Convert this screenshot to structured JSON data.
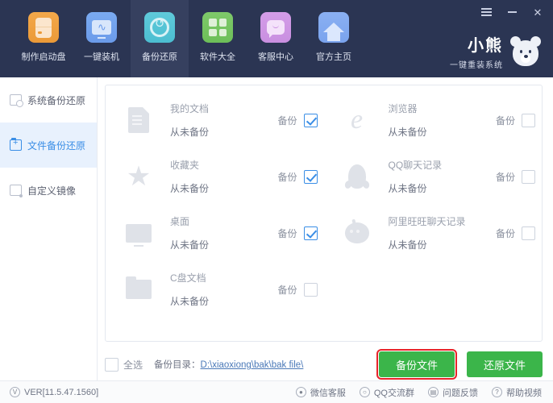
{
  "window": {
    "menu_icon": "hamburger-icon",
    "minimize_icon": "minimize-icon",
    "close_label": "✕"
  },
  "brand": {
    "name": "小熊",
    "slogan": "一键重装系统",
    "logo_icon": "bear-logo-icon"
  },
  "toolbar": {
    "active_index": 2,
    "tabs": [
      {
        "label": "制作启动盘",
        "icon": "usb-disk-icon"
      },
      {
        "label": "一键装机",
        "icon": "monitor-install-icon"
      },
      {
        "label": "备份还原",
        "icon": "backup-restore-icon"
      },
      {
        "label": "软件大全",
        "icon": "software-grid-icon"
      },
      {
        "label": "客服中心",
        "icon": "customer-service-icon"
      },
      {
        "label": "官方主页",
        "icon": "home-icon"
      }
    ]
  },
  "sidebar": {
    "active_index": 1,
    "items": [
      {
        "label": "系统备份还原",
        "icon": "system-backup-icon"
      },
      {
        "label": "文件备份还原",
        "icon": "file-backup-icon"
      },
      {
        "label": "自定义镜像",
        "icon": "custom-image-icon"
      }
    ]
  },
  "main": {
    "backup_label": "备份",
    "items": [
      {
        "title": "我的文档",
        "status": "从未备份",
        "icon": "document-icon",
        "checked": true
      },
      {
        "title": "浏览器",
        "status": "从未备份",
        "icon": "ie-browser-icon",
        "checked": false
      },
      {
        "title": "收藏夹",
        "status": "从未备份",
        "icon": "star-favorites-icon",
        "checked": true
      },
      {
        "title": "QQ聊天记录",
        "status": "从未备份",
        "icon": "qq-penguin-icon",
        "checked": false
      },
      {
        "title": "桌面",
        "status": "从未备份",
        "icon": "desktop-monitor-icon",
        "checked": true
      },
      {
        "title": "阿里旺旺聊天记录",
        "status": "从未备份",
        "icon": "aliwangwang-icon",
        "checked": false
      },
      {
        "title": "C盘文档",
        "status": "从未备份",
        "icon": "folder-icon",
        "checked": false
      }
    ]
  },
  "actionbar": {
    "select_all_label": "全选",
    "select_all_checked": false,
    "backup_dir_label": "备份目录：",
    "backup_dir_path": "D:\\xiaoxiong\\bak\\bak file\\",
    "backup_button": "备份文件",
    "restore_button": "还原文件",
    "highlight_color": "#e8232a",
    "button_color": "#3bb54a"
  },
  "footer": {
    "version": "VER[11.5.47.1560]",
    "version_icon": "circled-v-icon",
    "links": [
      {
        "label": "微信客服",
        "icon": "wechat-icon",
        "glyph": "●"
      },
      {
        "label": "QQ交流群",
        "icon": "qq-group-icon",
        "glyph": "○"
      },
      {
        "label": "问题反馈",
        "icon": "feedback-icon",
        "glyph": "▤"
      },
      {
        "label": "帮助视频",
        "icon": "help-video-icon",
        "glyph": "?"
      }
    ]
  }
}
